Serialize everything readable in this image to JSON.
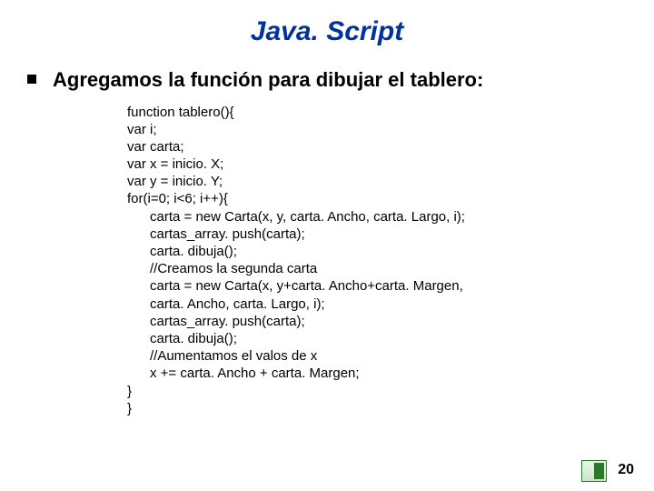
{
  "title": "Java. Script",
  "bullet": "Agregamos la función para dibujar el tablero:",
  "code": "function tablero(){\nvar i;\nvar carta;\nvar x = inicio. X;\nvar y = inicio. Y;\nfor(i=0; i<6; i++){\n      carta = new Carta(x, y, carta. Ancho, carta. Largo, i);\n      cartas_array. push(carta);\n      carta. dibuja();\n      //Creamos la segunda carta\n      carta = new Carta(x, y+carta. Ancho+carta. Margen,\n      carta. Ancho, carta. Largo, i);\n      cartas_array. push(carta);\n      carta. dibuja();\n      //Aumentamos el valos de x\n      x += carta. Ancho + carta. Margen;\n}\n}",
  "page_number": "20"
}
